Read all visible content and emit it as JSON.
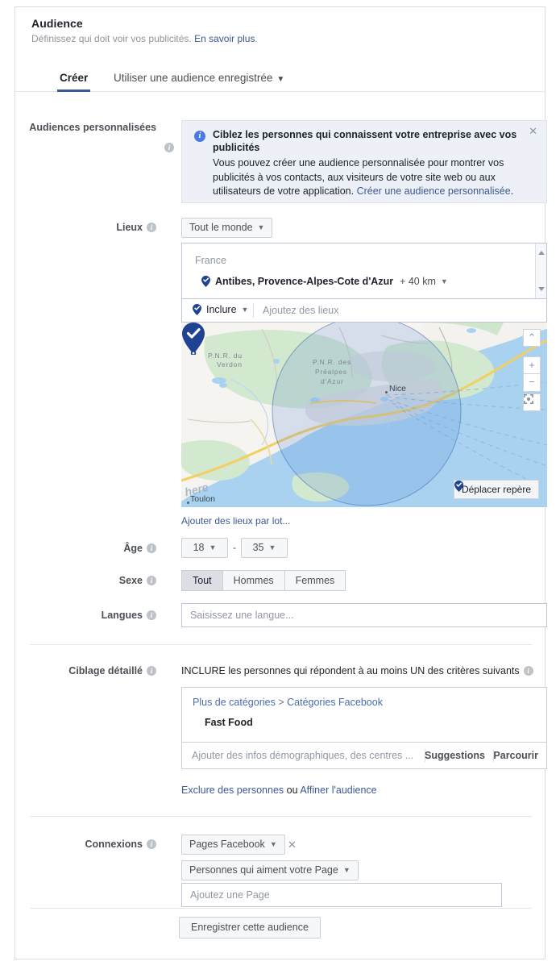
{
  "header": {
    "title": "Audience",
    "subtitle": "Définissez qui doit voir vos publicités.",
    "learn_more": "En savoir plus",
    "period": "."
  },
  "tabs": {
    "create": "Créer",
    "saved": "Utiliser une audience enregistrée",
    "caret": "▼"
  },
  "custom_audiences": {
    "label": "Audiences personnalisées",
    "banner_title": "Ciblez les personnes qui connaissent votre entreprise avec vos publicités",
    "banner_body": "Vous pouvez créer une audience personnalisée pour montrer vos publicités à vos contacts, aux visiteurs de votre site web ou aux utilisateurs de votre application.",
    "banner_link": "Créer une audience personnalisée",
    "banner_period": ".",
    "close": "✕"
  },
  "locations": {
    "label": "Lieux",
    "scope_button": "Tout le monde",
    "country": "France",
    "selected_place": "Antibes, Provence-Alpes-Cote d'Azur",
    "radius": "+ 40 km",
    "include_button": "Inclure",
    "add_placeholder": "Ajoutez des lieux",
    "bulk_link": "Ajouter des lieux par lot...",
    "map": {
      "park_label_1": "P.N.R. du",
      "park_label_1b": "Verdon",
      "park_label_2": "P.N.R. des",
      "park_label_2b": "Préalpes",
      "park_label_2c": "d'Azur",
      "city_nice": "Nice",
      "city_toulon": "Toulon",
      "watermark": "here",
      "move_pin_button": "Déplacer repère",
      "zoom_in": "+",
      "zoom_out": "−",
      "collapse": "⌃"
    }
  },
  "age": {
    "label": "Âge",
    "min": "18",
    "separator": "-",
    "max": "35"
  },
  "gender": {
    "label": "Sexe",
    "options": [
      "Tout",
      "Hommes",
      "Femmes"
    ],
    "selected": "Tout"
  },
  "languages": {
    "label": "Langues",
    "placeholder": "Saisissez une langue..."
  },
  "detailed_targeting": {
    "label": "Ciblage détaillé",
    "heading": "INCLURE les personnes qui répondent à au moins UN des critères suivants",
    "breadcrumb_parent": "Plus de catégories",
    "breadcrumb_sep": ">",
    "breadcrumb_child": "Catégories Facebook",
    "item": "Fast Food",
    "input_placeholder": "Ajouter des infos démographiques, des centres ...",
    "suggestions_button": "Suggestions",
    "browse_button": "Parcourir",
    "exclude_link": "Exclure des personnes",
    "or_text": "ou",
    "refine_link": "Affiner l'audience"
  },
  "connections": {
    "label": "Connexions",
    "type_button": "Pages Facebook",
    "remove": "✕",
    "relation_button": "Personnes qui aiment votre Page",
    "page_placeholder": "Ajoutez une Page"
  },
  "footer": {
    "save_button": "Enregistrer cette audience"
  },
  "colors": {
    "accent": "#3b5998",
    "link": "#3b5998",
    "banner_bg": "#edf1f7",
    "pin": "#1f4293",
    "sea": "#a8d2f0"
  }
}
